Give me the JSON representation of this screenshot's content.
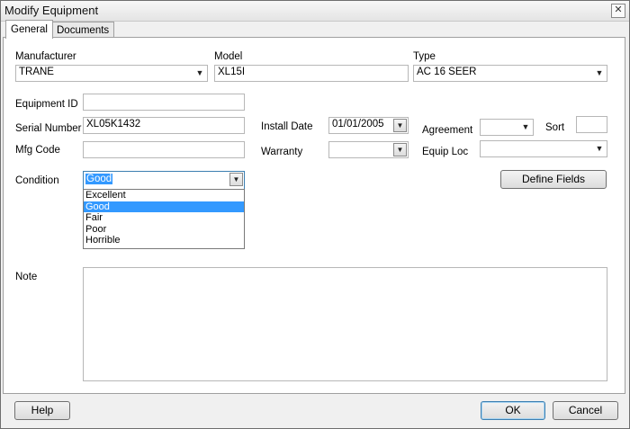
{
  "window": {
    "title": "Modify Equipment",
    "close_glyph": "✕"
  },
  "tabs": [
    {
      "label": "General"
    },
    {
      "label": "Documents"
    }
  ],
  "fields": {
    "manufacturer": {
      "label": "Manufacturer",
      "value": "TRANE"
    },
    "model": {
      "label": "Model",
      "value": "XL15I"
    },
    "type": {
      "label": "Type",
      "value": "AC 16 SEER"
    },
    "equipment_id": {
      "label": "Equipment ID",
      "value": ""
    },
    "serial_number": {
      "label": "Serial Number",
      "value": "XL05K1432"
    },
    "mfg_code": {
      "label": "Mfg Code",
      "value": ""
    },
    "install_date": {
      "label": "Install Date",
      "value": "01/01/2005"
    },
    "warranty": {
      "label": "Warranty",
      "value": ""
    },
    "agreement": {
      "label": "Agreement",
      "value": ""
    },
    "sort": {
      "label": "Sort",
      "value": ""
    },
    "equip_loc": {
      "label": "Equip Loc",
      "value": ""
    },
    "condition": {
      "label": "Condition",
      "value": "Good",
      "options": [
        "Excellent",
        "Good",
        "Fair",
        "Poor",
        "Horrible"
      ]
    },
    "note": {
      "label": "Note",
      "value": ""
    }
  },
  "buttons": {
    "define_fields": "Define Fields",
    "help": "Help",
    "ok": "OK",
    "cancel": "Cancel"
  },
  "icons": {
    "dropdown_arrow": "▼"
  }
}
